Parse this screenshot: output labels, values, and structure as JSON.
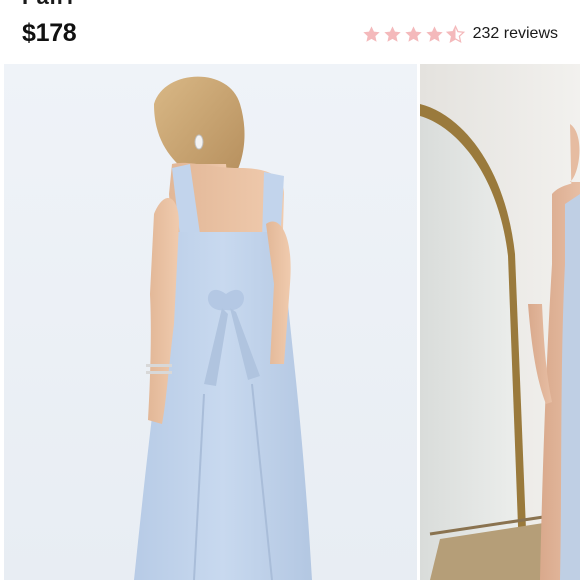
{
  "product": {
    "title": "Fairf",
    "price": "$178"
  },
  "rating": {
    "value": 4.5,
    "max": 5,
    "reviews_label": "232 reviews",
    "star_color": "#f4b9bb",
    "star_empty_color": "#f4d8d9"
  },
  "gallery": {
    "images": [
      {
        "icon": "product-photo-back-view",
        "alt": ""
      },
      {
        "icon": "product-photo-mirror",
        "alt": ""
      }
    ],
    "dress_color": "#c4d6ee"
  }
}
